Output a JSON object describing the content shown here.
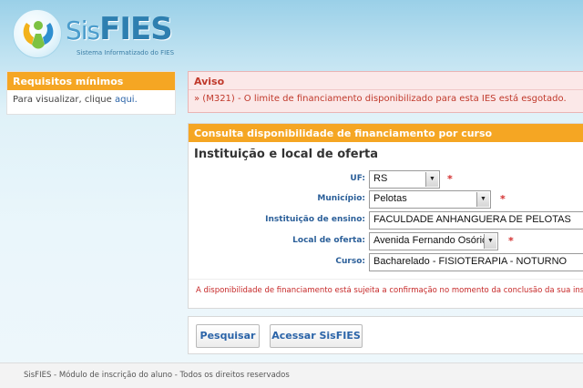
{
  "header": {
    "logo_prefix": "Sis",
    "logo_name": "FIES",
    "logo_subtitle": "Sistema Informatizado do FIES",
    "colors": {
      "accent": "#f5a623",
      "brand": "#2e7fb0",
      "error": "#c0392b"
    }
  },
  "sidebar": {
    "title": "Requisitos mínimos",
    "text": "Para visualizar, clique ",
    "link": "aqui."
  },
  "notice": {
    "title": "Aviso",
    "message": "» (M321) - O limite de financiamento disponibilizado para esta IES está esgotado."
  },
  "consulta": {
    "title": "Consulta disponibilidade de financiamento por curso",
    "section": "Instituição e local de oferta",
    "fields": {
      "uf": {
        "label": "UF:",
        "value": "RS"
      },
      "municipio": {
        "label": "Município:",
        "value": "Pelotas"
      },
      "instituicao": {
        "label": "Instituição de ensino:",
        "value": "FACULDADE ANHANGUERA DE PELOTAS"
      },
      "local": {
        "label": "Local de oferta:",
        "value": "Avenida Fernando Osório"
      },
      "curso": {
        "label": "Curso:",
        "value": "Bacharelado - FISIOTERAPIA - NOTURNO"
      }
    },
    "required_mark": "*",
    "warning": "A disponibilidade de financiamento está sujeita a confirmação no momento da conclusão da sua inscrição."
  },
  "buttons": {
    "search": "Pesquisar",
    "access": "Acessar SisFIES"
  },
  "footer": {
    "text": "SisFIES - Módulo de inscrição do aluno - Todos os direitos reservados"
  }
}
